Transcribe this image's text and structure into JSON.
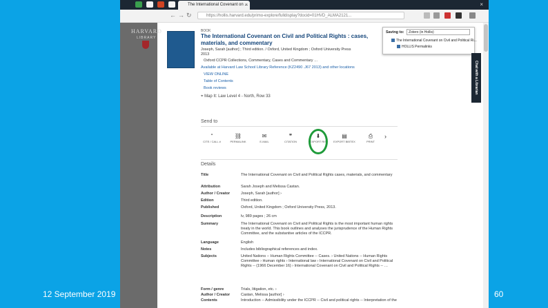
{
  "slide": {
    "date": "12 September 2019",
    "page_number": "60",
    "close_symbol": "×"
  },
  "browser": {
    "tab_title": "The International Covenant on ...",
    "url": "https://hollis.harvard.edu/primo-explore/fulldisplay?docid=01HVD_ALMA2121... ",
    "accent": "#1c2733"
  },
  "library": {
    "logo": "HARVARD",
    "logo_sub": "LIBRARY"
  },
  "record": {
    "type": "BOOK",
    "title": "The International Covenant on Civil and Political Rights : cases, materials, and commentary",
    "authors_line": "Joseph, Sarah [author] ; Third edition. / Oxford, United Kingdom ; Oxford University Press",
    "year": "2013",
    "series": "Oxford CCPR Collections, Commentary, Cases and Commentary …",
    "availability": "Available at Harvard Law School Library Reference (KZ2490 .J67 2013) and other locations",
    "view_online": "VIEW ONLINE",
    "toc": "Table of Contents",
    "book_reviews": "Book reviews",
    "location": "Map It: Law Level 4 - North, Row 33"
  },
  "send_to": {
    "title": "Send to",
    "items": [
      {
        "label": "CITE / CALL #",
        "glyph": "“"
      },
      {
        "label": "PERMALINK",
        "glyph": "⛓"
      },
      {
        "label": "E-MAIL",
        "glyph": "✉"
      },
      {
        "label": "CITATION",
        "glyph": "❞"
      },
      {
        "label": "EXPORT RIS",
        "glyph": "⬇"
      },
      {
        "label": "EXPORT BIBTEX",
        "glyph": "▤"
      },
      {
        "label": "PRINT",
        "glyph": "⎙"
      }
    ],
    "next": "›"
  },
  "details": {
    "title": "Details",
    "rows": [
      {
        "label": "Title",
        "value": "The International Covenant on Civil and Political Rights cases, materials, and commentary"
      },
      {
        "label": "Attribution",
        "value": "Sarah Joseph and Melissa Castan."
      },
      {
        "label": "Author / Creator",
        "value": "Joseph, Sarah [author] ›"
      },
      {
        "label": "Edition",
        "value": "Third edition."
      },
      {
        "label": "Published",
        "value": "Oxford, United Kingdom ; Oxford University Press, 2013."
      },
      {
        "label": "Description",
        "value": "lv, 989 pages ; 26 cm"
      },
      {
        "label": "Summary",
        "value": "The International Covenant on Civil and Political Rights is the most important human rights treaty in the world. This book outlines and analyses the jurisprudence of the Human Rights Committee, and the substantive articles of the ICCPR."
      },
      {
        "label": "Language",
        "value": "English"
      },
      {
        "label": "Notes",
        "value": "Includes bibliographical references and index."
      },
      {
        "label": "Subjects",
        "value": "United Nations -- Human Rights Committee -- Cases. ›  United Nations -- Human Rights Committee ›  Human rights ›  International law ›  International Covenant on Civil and Political Rights -- (1966 December 16) ›  International Covenant on Civil and Political Rights -- …"
      },
      {
        "label": "Form / genre",
        "value": "Trials, litigation, etc. ›"
      },
      {
        "label": "Author / Creator",
        "value": "Castan, Melissa [author] ›"
      },
      {
        "label": "Contents",
        "value": "Introduction -- Admissibility under the ICCPR -- Civil and political rights -- Interpretation of the"
      }
    ]
  },
  "save_panel": {
    "label": "Saving to:",
    "selected": "Zotero (in Hollis)",
    "items": [
      "The International Covenant on Civil and Political Ri...",
      "HOLLIS Permalinks"
    ]
  },
  "chat": {
    "label": "Chat with a Librarian"
  }
}
